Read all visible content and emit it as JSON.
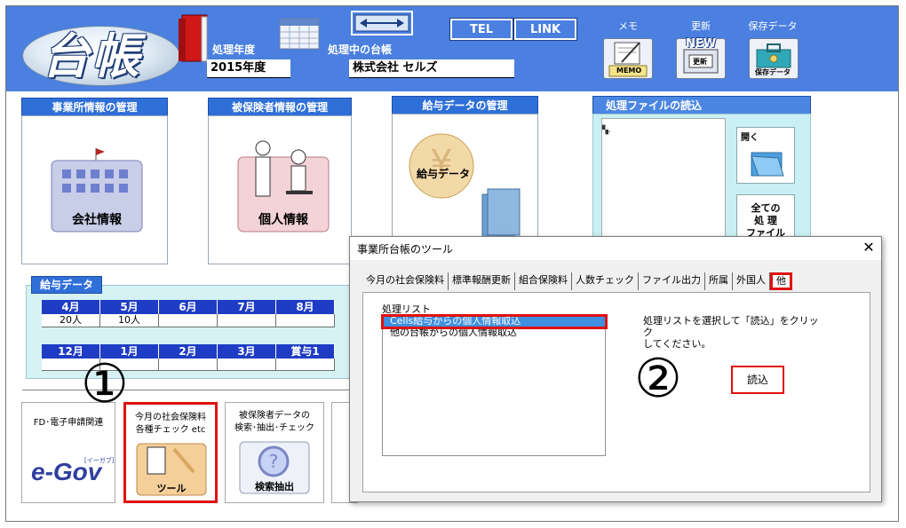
{
  "header": {
    "logo": "台帳",
    "year_label": "処理年度",
    "year_value": "2015年度",
    "ledger_label": "処理中の台帳",
    "ledger_value": "株式会社 セルズ",
    "tel_label": "TEL",
    "link_label": "LINK",
    "memo_label": "メモ",
    "memo_icon_text": "MEMO",
    "update_label": "更新",
    "update_icon_new": "NEW",
    "update_icon_text": "更新",
    "save_label": "保存データ",
    "save_icon_text": "保存データ"
  },
  "panels": {
    "company_title": "事業所情報の管理",
    "company_caption": "会社情報",
    "insured_title": "被保険者情報の管理",
    "insured_caption": "個人情報",
    "salary_title": "給与データの管理",
    "salary_caption": "給与データ",
    "files_title": "処理ファイルの読込",
    "files_open": "開く",
    "files_all_1": "全ての",
    "files_all_2": "処 理",
    "files_all_3": "ファイル"
  },
  "salary_data": {
    "title": "給与データ",
    "row1_months": [
      "4月",
      "5月",
      "6月",
      "7月",
      "8月"
    ],
    "row1_values": [
      "20人",
      "10人",
      "",
      "",
      ""
    ],
    "row2_months": [
      "12月",
      "1月",
      "2月",
      "3月",
      "賞与1"
    ],
    "row2_values": [
      "",
      "",
      "",
      "",
      ""
    ]
  },
  "bottom": {
    "fd_label": "FD･電子申請関連",
    "egov_small": "[イーガブ]",
    "egov_text": "e-Gov",
    "tool_line1": "今月の社会保険料",
    "tool_line2": "各種チェック etc",
    "tool_caption": "ツール",
    "search_line1": "被保険者データの",
    "search_line2": "検索･抽出･チェック",
    "search_caption": "検索抽出"
  },
  "annotations": {
    "circle1": "①",
    "circle2": "②"
  },
  "dialog": {
    "title": "事業所台帳のツール",
    "close": "✕",
    "tabs": [
      "今月の社会保険料",
      "標準報酬更新",
      "組合保険料",
      "人数チェック",
      "ファイル出力",
      "所属",
      "外国人",
      "他"
    ],
    "list_label": "処理リスト",
    "list_items": [
      "Cells給与からの個人情報取込",
      "他の台帳からの個人情報取込"
    ],
    "message_line1": "処理リストを選択して「読込」をクリック",
    "message_line2": "してください。",
    "read_button": "読込"
  },
  "colors": {
    "header_blue": "#4b7fe0",
    "panel_title_blue": "#2f6fd8",
    "highlight_red": "#e01010"
  }
}
